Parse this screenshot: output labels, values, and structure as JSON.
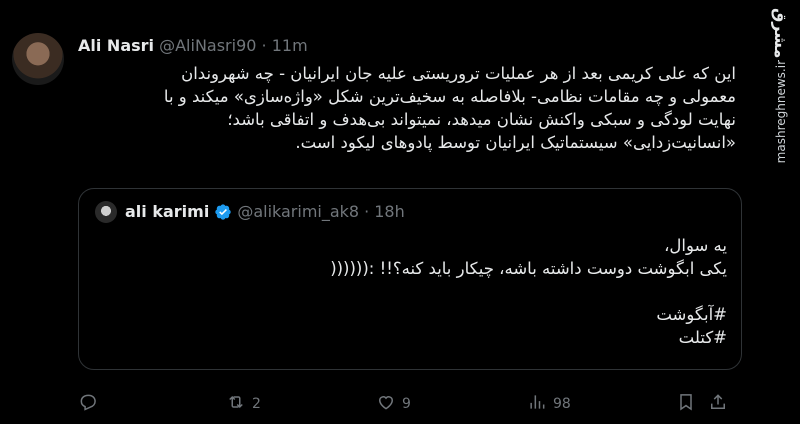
{
  "tweet": {
    "author_name": "Ali Nasri",
    "author_handle": "@AliNasri90",
    "separator": "·",
    "time": "11m",
    "text_lines": [
      "این که علی کریمی بعد از هر عملیات تروریستی علیه جان ایرانیان - چه شهروندان",
      "معمولی و چه مقامات نظامی- بلافاصله به سخیف‌ترین شکل «واژه‌سازی» میکند و با",
      "نهایت لودگی و سبکی واکنش نشان میدهد، نمیتواند بی‌هدف و اتفاقی باشد؛",
      "«انسانیت‌زدایی» سیستماتیک ایرانیان توسط پادوهای لیکود است."
    ]
  },
  "quote": {
    "author_name": "ali karimi",
    "author_handle": "@alikarimi_ak8",
    "separator": "·",
    "time": "18h",
    "text_lines": [
      "یه سوال،",
      "یکی ابگوشت دوست داشته باشه، چیکار باید کنه؟!! :((((((",
      "",
      "#آبگوشت",
      "#کتلت"
    ]
  },
  "actions": {
    "reply_count": "",
    "retweet_count": "2",
    "like_count": "9",
    "views_count": "98"
  },
  "watermark": {
    "logo": "مشرق",
    "url": "mashreghnews.ir"
  },
  "colors": {
    "background": "#000000",
    "text": "#e7e9ea",
    "muted": "#71767b",
    "verified": "#1d9bf0"
  }
}
